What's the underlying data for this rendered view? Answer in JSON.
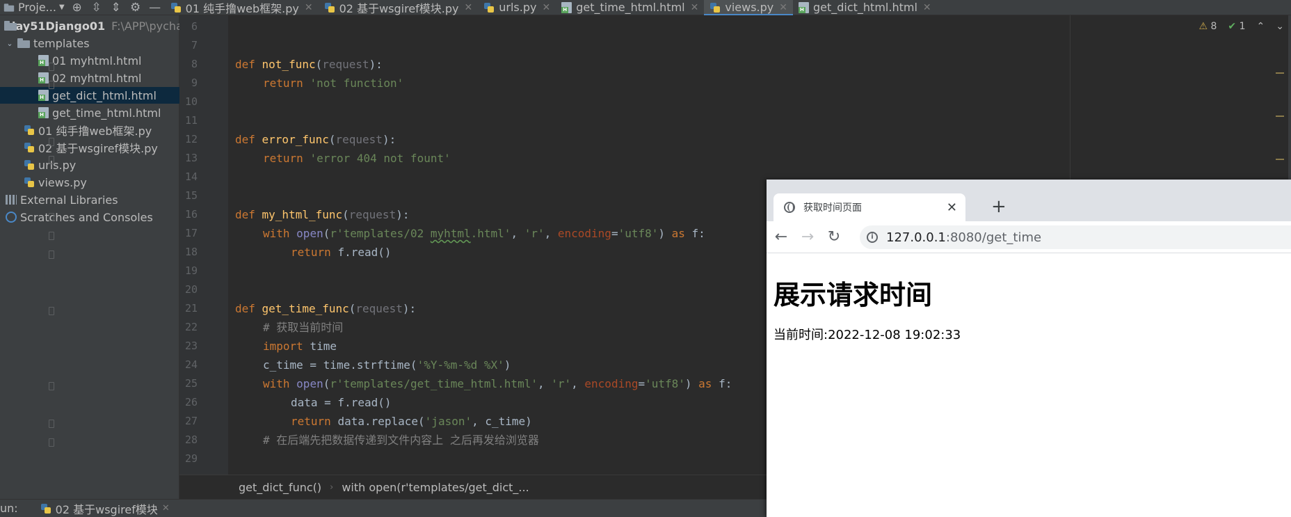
{
  "ide": {
    "project_label": "Proje...",
    "tabs": [
      {
        "label": "01 纯手撸web框架.py",
        "type": "py"
      },
      {
        "label": "02 基于wsgiref模块.py",
        "type": "py"
      },
      {
        "label": "urls.py",
        "type": "py"
      },
      {
        "label": "get_time_html.html",
        "type": "html"
      },
      {
        "label": "views.py",
        "type": "py",
        "active": true
      },
      {
        "label": "get_dict_html.html",
        "type": "html"
      }
    ],
    "tree": {
      "root_label": "day51Django01",
      "root_path": "F:\\APP\\pycha",
      "templates_label": "templates",
      "items": [
        {
          "label": "01 myhtml.html"
        },
        {
          "label": "02 myhtml.html"
        },
        {
          "label": "get_dict_html.html",
          "selected": true
        },
        {
          "label": "get_time_html.html"
        }
      ],
      "files": [
        {
          "label": "01 纯手撸web框架.py"
        },
        {
          "label": "02 基于wsgiref模块.py"
        },
        {
          "label": "urls.py"
        },
        {
          "label": "views.py"
        }
      ],
      "external_libraries": "External Libraries",
      "scratches": "Scratches and Consoles"
    },
    "inspections": {
      "warnings": "8",
      "weak_warnings": "1"
    },
    "line_numbers": [
      "6",
      "7",
      "8",
      "9",
      "10",
      "11",
      "12",
      "13",
      "14",
      "15",
      "16",
      "17",
      "18",
      "19",
      "20",
      "21",
      "22",
      "23",
      "24",
      "25",
      "26",
      "27",
      "28",
      "29"
    ],
    "code": {
      "l8_def": "def ",
      "l8_fn": "not_func",
      "l8_open": "(",
      "l8_param": "request",
      "l8_close": "):",
      "l9_ret": "return ",
      "l9_str": "'not function'",
      "l12_def": "def ",
      "l12_fn": "error_func",
      "l12_open": "(",
      "l12_param": "request",
      "l12_close": "):",
      "l13_ret": "return ",
      "l13_str": "'error 404 not fount'",
      "l16_def": "def ",
      "l16_fn": "my_html_func",
      "l16_open": "(",
      "l16_param": "request",
      "l16_close": "):",
      "l17_with": "with ",
      "l17_open_fn": "open",
      "l17_p": "(",
      "l17_str_a": "r'templates/02 ",
      "l17_str_b": "myhtml",
      "l17_str_c": ".html'",
      "l17_c1": ", ",
      "l17_str_r": "'r'",
      "l17_c2": ", ",
      "l17_kw": "encoding",
      "l17_eq": "=",
      "l17_enc": "'utf8'",
      "l17_cp": ") ",
      "l17_as": "as ",
      "l17_f": "f:",
      "l18_ret": "return ",
      "l18_rest": "f.read()",
      "l21_def": "def ",
      "l21_fn": "get_time_func",
      "l21_open": "(",
      "l21_param": "request",
      "l21_close": "):",
      "l22_cm": "# 获取当前时间",
      "l23_imp": "import ",
      "l23_mod": "time",
      "l24_a": "c_time = time.strftime(",
      "l24_str": "'%Y-%m-%d %X'",
      "l24_b": ")",
      "l25_with": "with ",
      "l25_open_fn": "open",
      "l25_p": "(",
      "l25_str": "r'templates/get_time_html.html'",
      "l25_c1": ", ",
      "l25_str_r": "'r'",
      "l25_c2": ", ",
      "l25_kw": "encoding",
      "l25_eq": "=",
      "l25_enc": "'utf8'",
      "l25_cp": ") ",
      "l25_as": "as ",
      "l25_f": "f:",
      "l26": "data = f.read()",
      "l27_ret": "return ",
      "l27_a": "data.replace(",
      "l27_str": "'jason'",
      "l27_b": ", c_time)",
      "l28_cm": "# 在后端先把数据传递到文件内容上 之后再发给浏览器"
    },
    "breadcrumb": [
      "get_dict_func()",
      "with open(r'templates/get_dict_..."
    ],
    "run": {
      "label": "un:",
      "tab": "02 基于wsgiref模块"
    }
  },
  "browser": {
    "tab_title": "获取时间页面",
    "url_host": "127.0.0.1",
    "url_path": ":8080/get_time",
    "heading": "展示请求时间",
    "body_text": "当前时间:2022-12-08 19:02:33"
  }
}
